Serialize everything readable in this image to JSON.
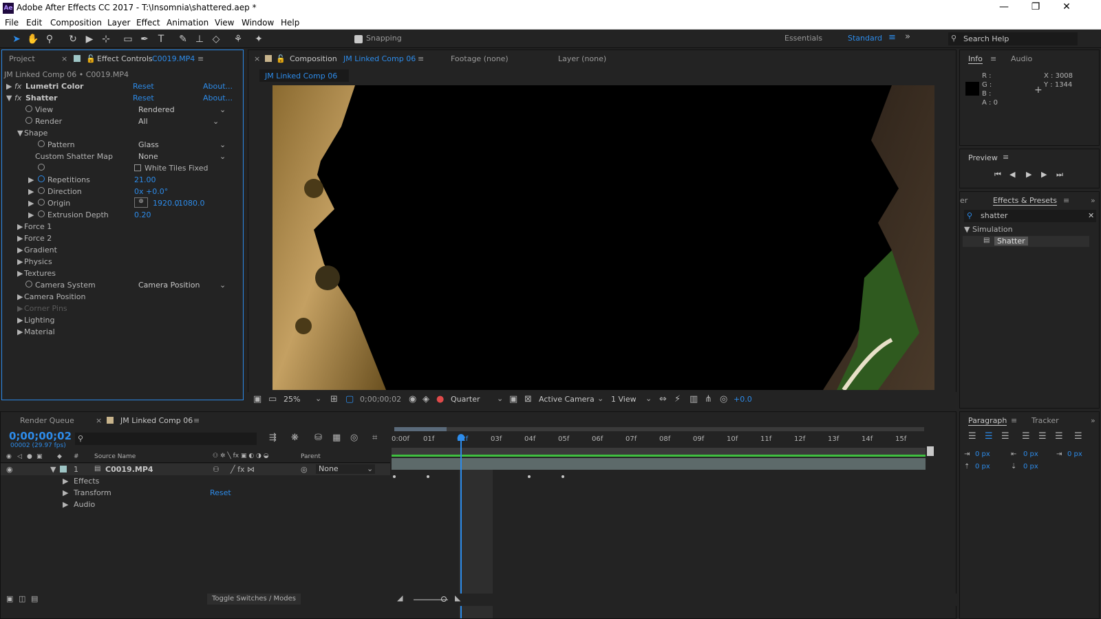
{
  "app": {
    "title": "Adobe After Effects CC 2017 - T:\\Insomnia\\shattered.aep *",
    "logo": "Ae"
  },
  "menu": [
    "File",
    "Edit",
    "Composition",
    "Layer",
    "Effect",
    "Animation",
    "View",
    "Window",
    "Help"
  ],
  "toolbar": {
    "snapping": "Snapping",
    "workspaces": [
      "Essentials",
      "Standard"
    ],
    "search_placeholder": "Search Help"
  },
  "left_panel": {
    "tabs": {
      "project": "Project",
      "effect_controls": "Effect Controls",
      "effect_controls_target": "C0019.MP4"
    },
    "breadcrumb": "JM Linked Comp 06 • C0019.MP4",
    "reset": "Reset",
    "about": "About...",
    "effects": [
      "Lumetri Color",
      "Shatter"
    ],
    "props": {
      "view": {
        "label": "View",
        "value": "Rendered"
      },
      "render": {
        "label": "Render",
        "value": "All"
      },
      "shape": "Shape",
      "pattern": {
        "label": "Pattern",
        "value": "Glass"
      },
      "custom_map": {
        "label": "Custom Shatter Map",
        "value": "None"
      },
      "white_tiles": "White Tiles Fixed",
      "repetitions": {
        "label": "Repetitions",
        "value": "21.00"
      },
      "direction": {
        "label": "Direction",
        "value": "0x +0.0°"
      },
      "origin": {
        "label": "Origin",
        "x": "1920.0",
        "y": "1080.0"
      },
      "extrusion": {
        "label": "Extrusion Depth",
        "value": "0.20"
      },
      "camera_system": {
        "label": "Camera System",
        "value": "Camera Position"
      }
    },
    "groups": [
      "Force 1",
      "Force 2",
      "Gradient",
      "Physics",
      "Textures"
    ],
    "groups2": [
      "Camera Position",
      "Corner Pins",
      "Lighting",
      "Material"
    ]
  },
  "comp_panel": {
    "tabs": {
      "composition": "Composition",
      "comp_name": "JM Linked Comp 06",
      "footage": "Footage (none)",
      "layer": "Layer (none)"
    },
    "flow_tab": "JM Linked Comp 06",
    "footer": {
      "zoom": "25%",
      "timecode": "0;00;00;02",
      "resolution": "Quarter",
      "camera": "Active Camera",
      "views": "1 View",
      "exposure": "+0.0"
    }
  },
  "info_panel": {
    "tabs": [
      "Info",
      "Audio"
    ],
    "r": "R :",
    "g": "G :",
    "b": "B :",
    "a": "A : 0",
    "x": "X : 3008",
    "y": "Y : 1344"
  },
  "preview_panel": {
    "title": "Preview"
  },
  "effects_presets": {
    "tab_left": "er",
    "title": "Effects & Presets",
    "search": "shatter",
    "category": "Simulation",
    "item": "Shatter"
  },
  "paragraph": {
    "tabs": [
      "Paragraph",
      "Tracker"
    ],
    "values": [
      "0 px",
      "0 px",
      "0 px",
      "0 px",
      "0 px"
    ]
  },
  "timeline": {
    "tabs": {
      "render_queue": "Render Queue",
      "comp": "JM Linked Comp 06"
    },
    "timecode": "0;00;00;02",
    "fps": "00002 (29.97 fps)",
    "columns": {
      "num": "#",
      "source": "Source Name",
      "parent": "Parent"
    },
    "layer": {
      "num": "1",
      "name": "C0019.MP4",
      "parent": "None"
    },
    "children": [
      "Effects",
      "Transform",
      "Audio"
    ],
    "reset": "Reset",
    "ruler": [
      "0:00f",
      "01f",
      "02f",
      "03f",
      "04f",
      "05f",
      "06f",
      "07f",
      "08f",
      "09f",
      "10f",
      "11f",
      "12f",
      "13f",
      "14f",
      "15f"
    ],
    "toggle": "Toggle Switches / Modes"
  }
}
